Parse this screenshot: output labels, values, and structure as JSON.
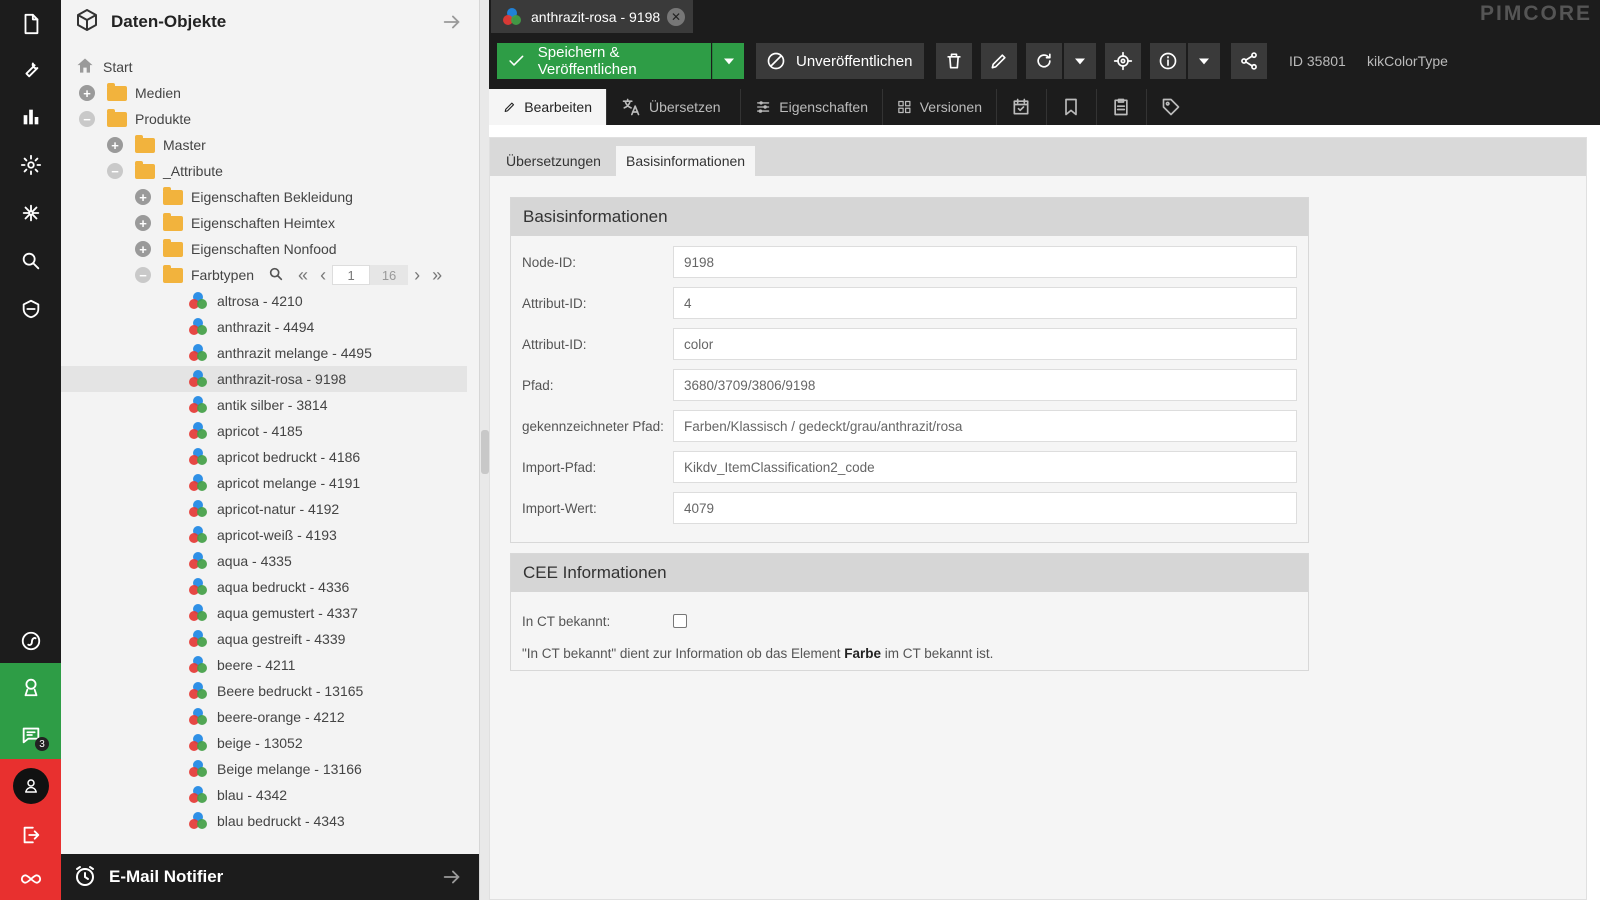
{
  "rail": {
    "icons": [
      "document-icon",
      "wrench-icon",
      "bar-chart-icon",
      "gear-icon",
      "network-icon",
      "search-icon",
      "shield-icon"
    ],
    "bottom_icons": [
      "symfony-icon",
      "profile-icon",
      "chat-icon",
      "user-icon",
      "logout-icon",
      "infinity-icon"
    ],
    "chat_badge": "3",
    "colors": {
      "dark": "#1c1c1c",
      "green": "#2e9d46",
      "red": "#e8302f"
    }
  },
  "tree": {
    "title": "Daten-Objekte",
    "rows": [
      {
        "label": "Start"
      },
      {
        "label": "Medien"
      },
      {
        "label": "Produkte"
      },
      {
        "label": "Master"
      },
      {
        "label": "_Attribute"
      },
      {
        "label": "Eigenschaften Bekleidung"
      },
      {
        "label": "Eigenschaften Heimtex"
      },
      {
        "label": "Eigenschaften Nonfood"
      },
      {
        "label": "Farbtypen"
      }
    ],
    "pager": {
      "current": "1",
      "total": "16"
    },
    "items": [
      "altrosa - 4210",
      "anthrazit - 4494",
      "anthrazit melange - 4495",
      "anthrazit-rosa - 9198",
      "antik silber - 3814",
      "apricot - 4185",
      "apricot bedruckt - 4186",
      "apricot melange - 4191",
      "apricot-natur - 4192",
      "apricot-weiß - 4193",
      "aqua - 4335",
      "aqua bedruckt - 4336",
      "aqua gemustert - 4337",
      "aqua gestreift - 4339",
      "beere - 4211",
      "Beere bedruckt - 13165",
      "beere-orange - 4212",
      "beige - 13052",
      "Beige melange - 13166",
      "blau - 4342",
      "blau bedruckt - 4343"
    ],
    "selected_item": "anthrazit-rosa - 9198",
    "footer_title": "E-Mail Notifier"
  },
  "editor": {
    "tab_title": "anthrazit-rosa - 9198",
    "logo": "PIMCORE",
    "toolbar": {
      "save_label": "Speichern & Veröffentlichen",
      "unpublish_label": "Unveröffentlichen",
      "id_label": "ID 35801",
      "class_label": "kikColorType"
    },
    "subtabs": {
      "edit": "Bearbeiten",
      "translate": "Übersetzen",
      "properties": "Eigenschaften",
      "versions": "Versionen"
    },
    "inner_tabs": {
      "translations": "Übersetzungen",
      "basic": "Basisinformationen"
    },
    "basic": {
      "title": "Basisinformationen",
      "fields": [
        {
          "label": "Node-ID:",
          "value": "9198"
        },
        {
          "label": "Attribut-ID:",
          "value": "4"
        },
        {
          "label": "Attribut-ID:",
          "value": "color"
        },
        {
          "label": "Pfad:",
          "value": "3680/3709/3806/9198"
        },
        {
          "label": "gekennzeichneter Pfad:",
          "value": "Farben/Klassisch / gedeckt/grau/anthrazit/rosa"
        },
        {
          "label": "Import-Pfad:",
          "value": "Kikdv_ItemClassification2_code"
        },
        {
          "label": "Import-Wert:",
          "value": "4079"
        }
      ]
    },
    "cee": {
      "title": "CEE Informationen",
      "checkbox_label": "In CT bekannt:",
      "checked": false,
      "note_before": "\"In CT bekannt\" dient zur Information ob das Element ",
      "note_bold": "Farbe",
      "note_after": " im CT bekannt ist."
    }
  }
}
